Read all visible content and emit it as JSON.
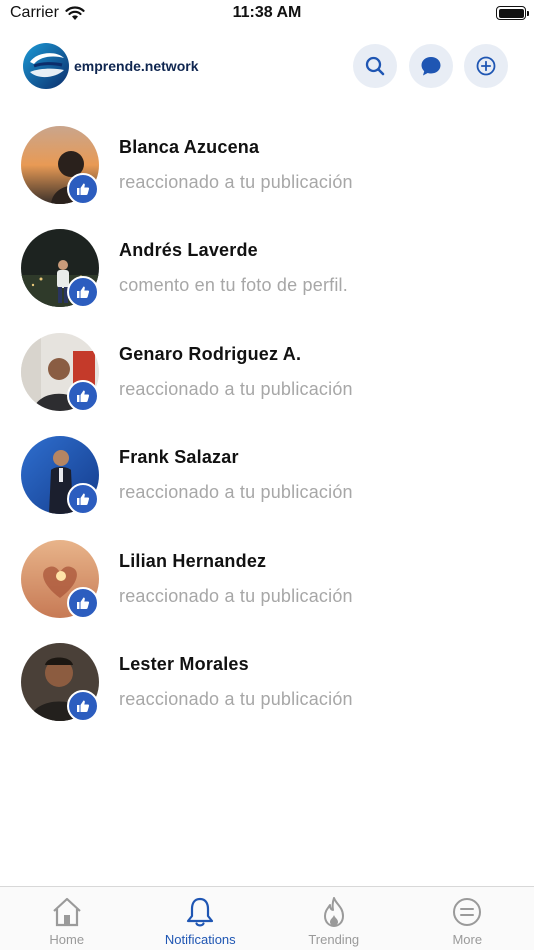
{
  "status_bar": {
    "carrier": "Carrier",
    "time": "11:38 AM"
  },
  "header": {
    "logo_text": "emprende.network",
    "buttons": [
      {
        "icon": "search-icon"
      },
      {
        "icon": "chat-bubble-icon"
      },
      {
        "icon": "plus-circle-icon"
      }
    ]
  },
  "notifications": [
    {
      "name": "Blanca Azucena",
      "action": "reaccionado a tu publicación",
      "badge_icon": "thumbs-up-icon"
    },
    {
      "name": "Andrés Laverde",
      "action": "comento en tu foto de perfil.",
      "badge_icon": "thumbs-up-icon"
    },
    {
      "name": "Genaro Rodriguez A.",
      "action": "reaccionado a tu publicación",
      "badge_icon": "thumbs-up-icon"
    },
    {
      "name": "Frank Salazar",
      "action": "reaccionado a tu publicación",
      "badge_icon": "thumbs-up-icon"
    },
    {
      "name": "Lilian Hernandez",
      "action": "reaccionado a tu publicación",
      "badge_icon": "thumbs-up-icon"
    },
    {
      "name": "Lester Morales",
      "action": "reaccionado a tu publicación",
      "badge_icon": "thumbs-up-icon"
    }
  ],
  "tab_bar": {
    "tabs": [
      {
        "label": "Home",
        "icon": "home-icon",
        "active": false
      },
      {
        "label": "Notifications",
        "icon": "bell-icon",
        "active": true
      },
      {
        "label": "Trending",
        "icon": "flame-icon",
        "active": false
      },
      {
        "label": "More",
        "icon": "menu-circle-icon",
        "active": false
      }
    ]
  },
  "colors": {
    "accent": "#1f56b3",
    "badge": "#2c5dbf",
    "header_button_bg": "#e8edf5",
    "secondary_text": "#a7a7a7"
  }
}
